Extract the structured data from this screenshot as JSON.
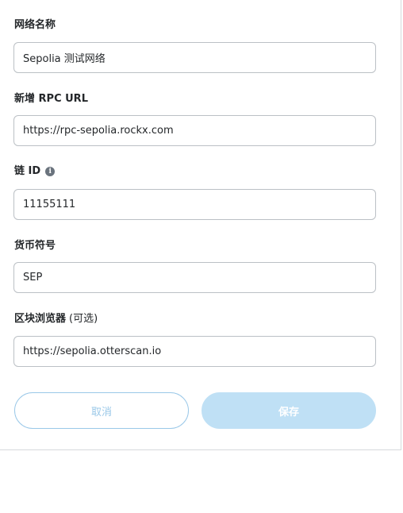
{
  "form": {
    "network_name": {
      "label": "网络名称",
      "value": "Sepolia 测试网络"
    },
    "rpc_url": {
      "label": "新增 RPC URL",
      "value": "https://rpc-sepolia.rockx.com"
    },
    "chain_id": {
      "label": "链 ID",
      "info_icon": "i",
      "value": "11155111"
    },
    "currency_symbol": {
      "label": "货币符号",
      "value": "SEP"
    },
    "block_explorer": {
      "label": "区块浏览器",
      "optional": "(可选)",
      "value": "https://sepolia.otterscan.io"
    }
  },
  "actions": {
    "cancel_label": "取消",
    "save_label": "保存"
  },
  "colors": {
    "primary_disabled": "#bfe0f5",
    "cancel_border": "#9ac8e8",
    "input_border": "#bbc0c5"
  }
}
